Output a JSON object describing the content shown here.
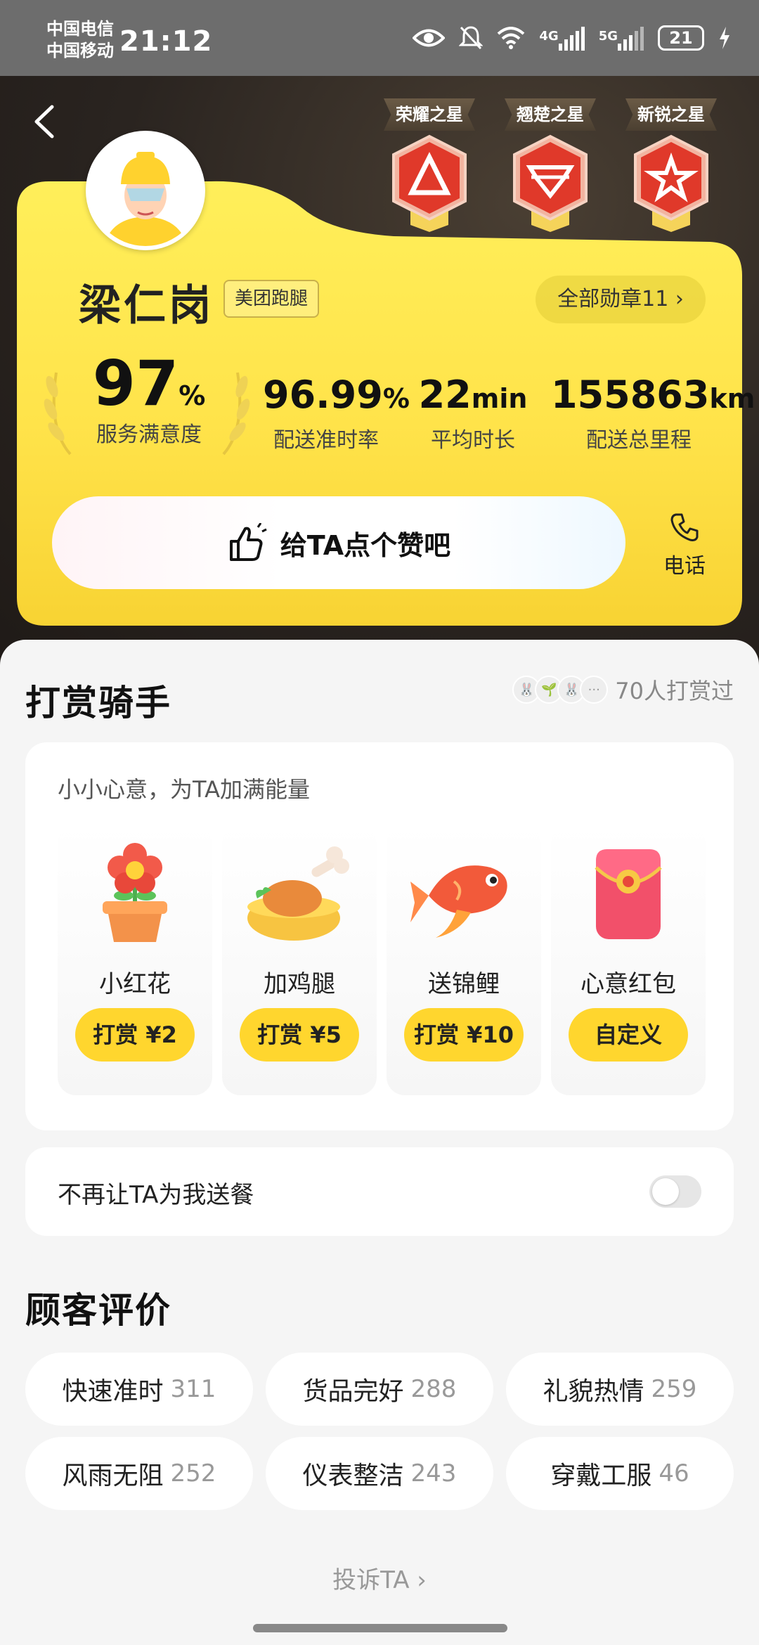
{
  "status_bar": {
    "carrier1": "中国电信",
    "carrier2": "中国移动",
    "time": "21:12",
    "net1": "4G",
    "net2": "5G",
    "battery": "21"
  },
  "medals": [
    {
      "label": "荣耀之星",
      "color": "#e8422f"
    },
    {
      "label": "翘楚之星",
      "color": "#e8422f"
    },
    {
      "label": "新锐之星",
      "color": "#e8422f"
    }
  ],
  "rider": {
    "name": "梁仁岗",
    "org": "美团跑腿",
    "medal_count": "全部勋章11"
  },
  "stats": [
    {
      "value": "97",
      "unit": "%",
      "label": "服务满意度"
    },
    {
      "value": "96.99",
      "unit": "%",
      "label": "配送准时率"
    },
    {
      "value": "22",
      "unit": "min",
      "label": "平均时长"
    },
    {
      "value": "155863",
      "unit": "km",
      "label": "配送总里程"
    }
  ],
  "like_button": "给TA点个赞吧",
  "phone_button": "电话",
  "tip": {
    "title": "打赏骑手",
    "tippers": "70人打赏过",
    "subtitle": "小小心意，为TA加满能量",
    "gifts": [
      {
        "name": "小红花",
        "button": "打赏 ¥2"
      },
      {
        "name": "加鸡腿",
        "button": "打赏 ¥5"
      },
      {
        "name": "送锦鲤",
        "button": "打赏 ¥10"
      },
      {
        "name": "心意红包",
        "button": "自定义"
      }
    ]
  },
  "block_option": "不再让TA为我送餐",
  "reviews": {
    "title": "顾客评价",
    "tags": [
      {
        "label": "快速准时",
        "count": "311"
      },
      {
        "label": "货品完好",
        "count": "288"
      },
      {
        "label": "礼貌热情",
        "count": "259"
      },
      {
        "label": "风雨无阻",
        "count": "252"
      },
      {
        "label": "仪表整洁",
        "count": "243"
      },
      {
        "label": "穿戴工服",
        "count": "46"
      }
    ]
  },
  "complain": "投诉TA",
  "colors": {
    "accent_yellow": "#ffd62e",
    "card_yellow": "#ffe54a",
    "status_bar": "#6d6d6d"
  }
}
